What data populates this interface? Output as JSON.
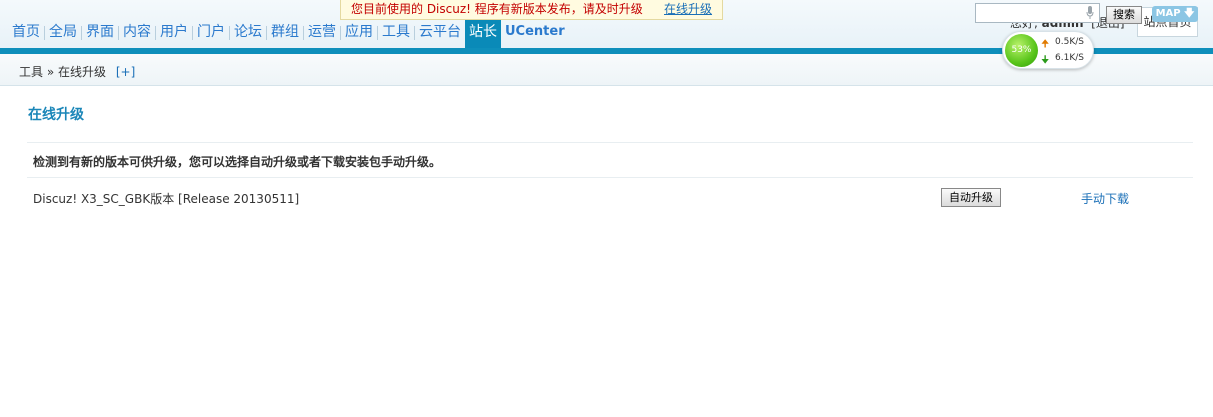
{
  "notice": {
    "text": "您目前使用的 Discuz! 程序有新版本发布，请及时升级",
    "link": "在线升级"
  },
  "nav": {
    "items": [
      "首页",
      "全局",
      "界面",
      "内容",
      "用户",
      "门户",
      "论坛",
      "群组",
      "运营",
      "应用",
      "工具",
      "云平台",
      "站长",
      "UCenter"
    ],
    "active_index": 12
  },
  "user": {
    "greeting": "您好,",
    "name": "admin",
    "logout": "[退出]",
    "site_home": "站点首页"
  },
  "speed": {
    "percent": "53%",
    "up": "0.5K/S",
    "down": "6.1K/S"
  },
  "breadcrumb": {
    "parent": "工具",
    "separator": "»",
    "current": "在线升级",
    "add": "[+]"
  },
  "search": {
    "value": "",
    "button": "搜索",
    "map": "MAP"
  },
  "main": {
    "title": "在线升级",
    "tip": "检测到有新的版本可供升级，您可以选择自动升级或者下载安装包手动升级。",
    "version": "Discuz! X3_SC_GBK版本 [Release 20130511]",
    "auto_button": "自动升级",
    "manual_link": "手动下载"
  },
  "colors": {
    "accent": "#0e8fbb",
    "nav_text": "#2b7acd",
    "notice_text": "#c30000"
  }
}
